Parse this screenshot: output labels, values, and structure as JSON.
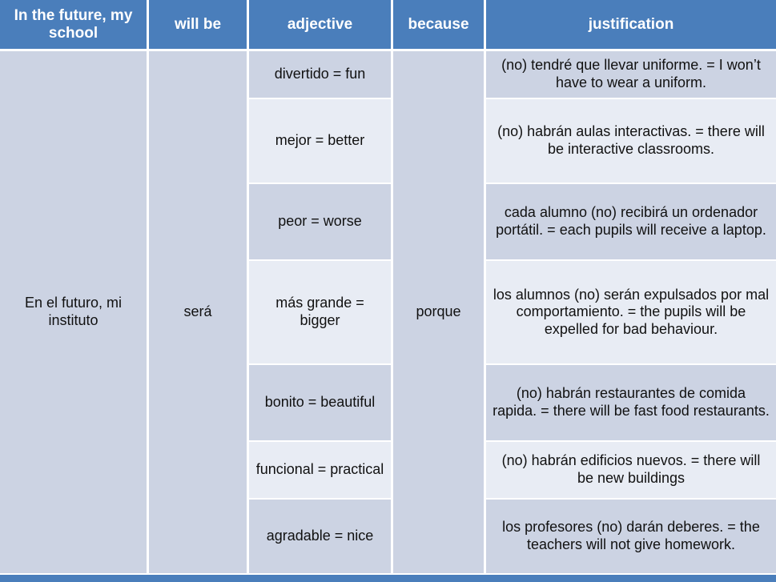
{
  "table": {
    "headers": [
      "In the future, my school",
      "will be",
      "adjective",
      "because",
      "justification"
    ],
    "merged": {
      "subject": "En el futuro, mi instituto",
      "verb": "será",
      "connective": "porque"
    },
    "rows": [
      {
        "adjective": "divertido = fun",
        "justification": "(no) tendré que llevar uniforme. = I won’t have to wear a uniform."
      },
      {
        "adjective": "mejor = better",
        "justification": "(no) habrán aulas interactivas. = there will be interactive classrooms."
      },
      {
        "adjective": "peor = worse",
        "justification": "cada alumno (no) recibirá un ordenador portátil. = each pupils will receive a laptop."
      },
      {
        "adjective": "más grande = bigger",
        "justification": "los alumnos (no) serán expulsados por mal comportamiento. = the pupils will be expelled for bad behaviour."
      },
      {
        "adjective": "bonito = beautiful",
        "justification": "(no) habrán restaurantes de comida rapida. = there will be fast food restaurants."
      },
      {
        "adjective": "funcional = practical",
        "justification": "(no) habrán edificios nuevos. = there will be new buildings"
      },
      {
        "adjective": "agradable = nice",
        "justification": "los profesores (no) darán deberes. = the teachers will not give homework."
      }
    ]
  },
  "colors": {
    "header_blue": "#4a7ebb",
    "band_dark": "#ccd3e3",
    "band_light": "#e8ecf4",
    "grid_white": "#ffffff",
    "text": "#111111"
  }
}
